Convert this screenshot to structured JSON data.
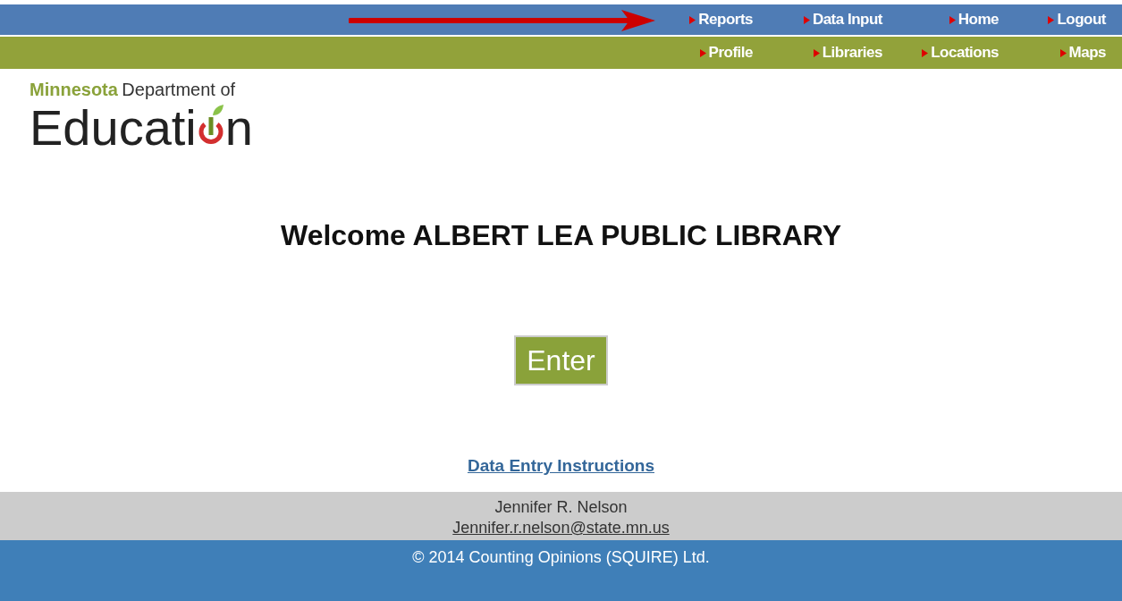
{
  "nav_rows": [
    [
      {
        "label": "Reports"
      },
      {
        "label": "Data Input"
      },
      {
        "label": "Home"
      },
      {
        "label": "Logout"
      }
    ],
    [
      {
        "label": "Profile"
      },
      {
        "label": "Libraries"
      },
      {
        "label": "Locations"
      },
      {
        "label": "Maps"
      }
    ]
  ],
  "logo": {
    "state": "Minnesota",
    "department": "Department of",
    "word_start": "Educati",
    "word_end": "n"
  },
  "welcome": "Welcome ALBERT LEA PUBLIC LIBRARY",
  "enter_button": "Enter",
  "instructions_link": "Data Entry Instructions",
  "contact": {
    "name": "Jennifer R. Nelson",
    "email": "Jennifer.r.nelson@state.mn.us"
  },
  "copyright": "© 2014 Counting Opinions (SQUIRE) Ltd."
}
